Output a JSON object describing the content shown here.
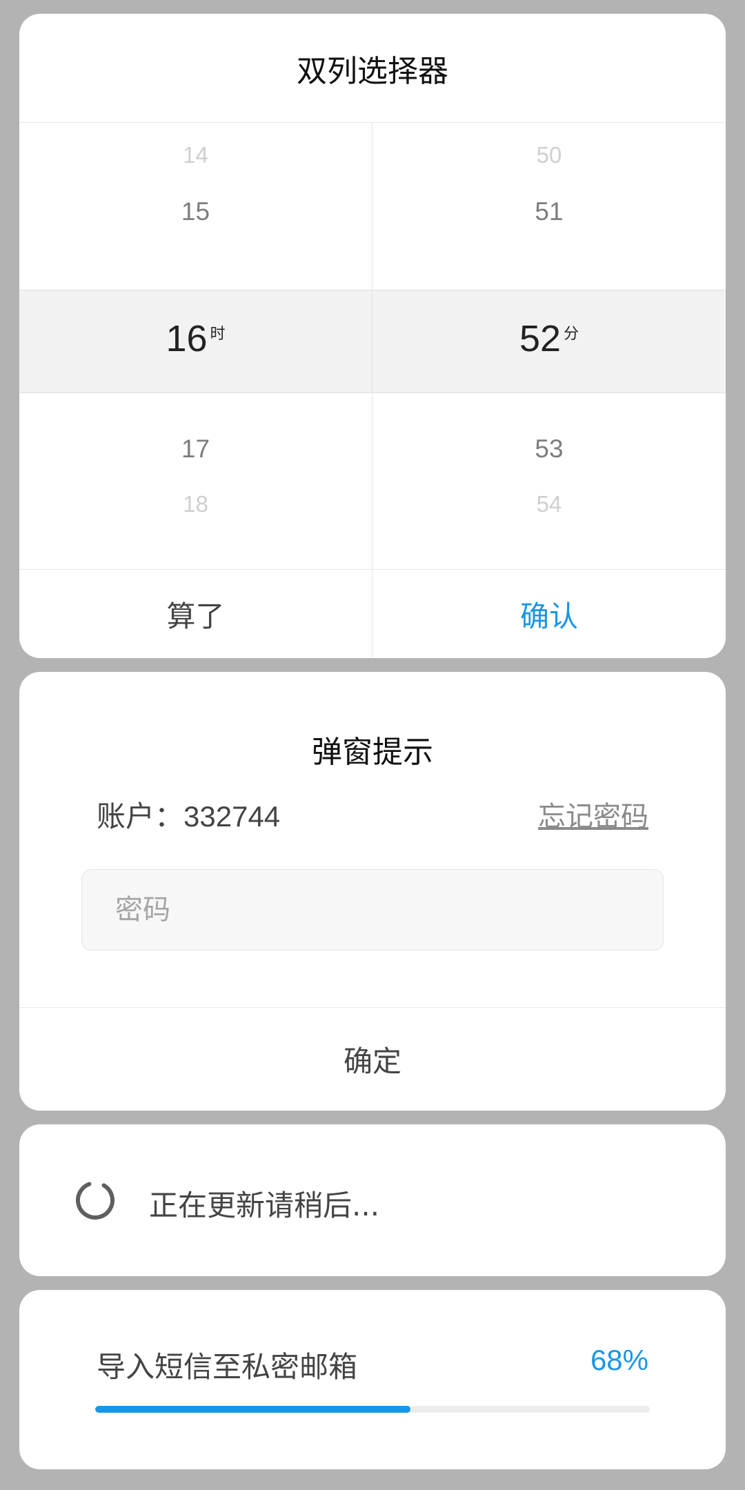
{
  "picker": {
    "title": "双列选择器",
    "hours": {
      "far_above": "14",
      "near_above": "15",
      "selected": "16",
      "unit": "时",
      "near_below": "17",
      "far_below": "18"
    },
    "minutes": {
      "far_above": "50",
      "near_above": "51",
      "selected": "52",
      "unit": "分",
      "near_below": "53",
      "far_below": "54"
    },
    "cancel_label": "算了",
    "confirm_label": "确认"
  },
  "dialog": {
    "title": "弹窗提示",
    "account_label": "账户：",
    "account_value": "332744",
    "forgot_label": "忘记密码",
    "password_placeholder": "密码",
    "ok_label": "确定"
  },
  "loading": {
    "text": "正在更新请稍后..."
  },
  "progress": {
    "label": "导入短信至私密邮箱",
    "percent_text": "68%",
    "value": 0.568
  },
  "colors": {
    "accent": "#1a96e6",
    "overlay": "#b3b3b3"
  }
}
